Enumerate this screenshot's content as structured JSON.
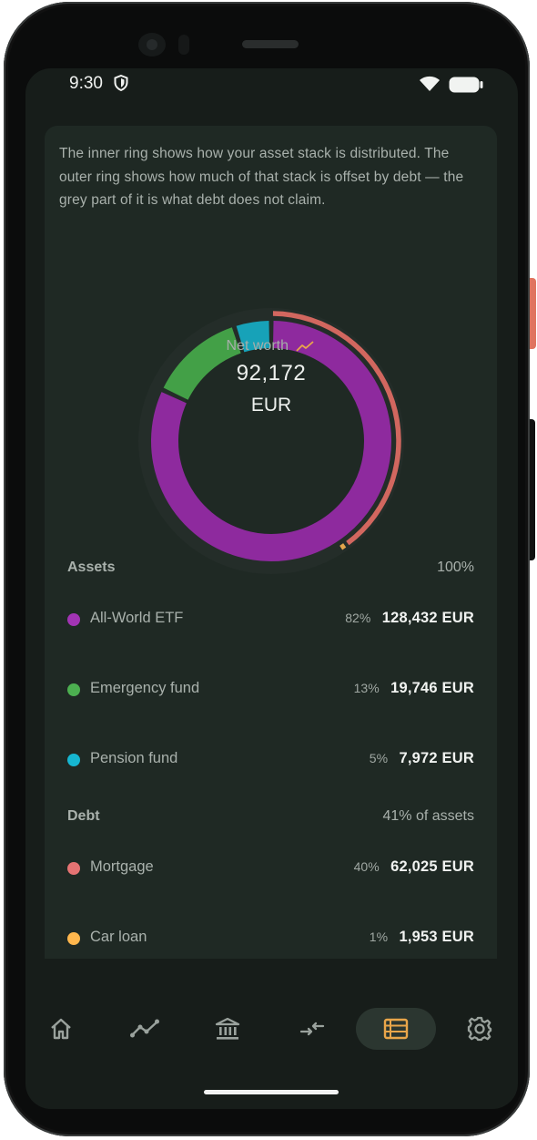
{
  "status_bar": {
    "time": "9:30",
    "icons": [
      "shield-icon",
      "wifi-icon",
      "battery-icon"
    ]
  },
  "intro_text": "The inner ring shows how your asset stack is distributed. The outer ring shows how much of that stack is offset by debt — the grey part of it is what debt does not claim.",
  "donut": {
    "label": "Net worth",
    "trend_icon": "trend-up-icon",
    "value": "92,172",
    "unit": "EUR",
    "colors": {
      "etf": "#8e2a9e",
      "emergency": "#43a047",
      "pension": "#17a2b8",
      "mortgage": "#d2675f",
      "car": "#e3a64c",
      "ring_track": "#242d29"
    }
  },
  "assets": {
    "title": "Assets",
    "total": "100%",
    "items": [
      {
        "name": "All-World ETF",
        "percent": "82%",
        "amount": "128,432 EUR",
        "color": "#a234b4",
        "share": 82
      },
      {
        "name": "Emergency fund",
        "percent": "13%",
        "amount": "19,746 EUR",
        "color": "#4caf50",
        "share": 13
      },
      {
        "name": "Pension fund",
        "percent": "5%",
        "amount": "7,972 EUR",
        "color": "#16b6d1",
        "share": 5
      }
    ]
  },
  "debt": {
    "title": "Debt",
    "total": "41% of assets",
    "items": [
      {
        "name": "Mortgage",
        "percent": "40%",
        "amount": "62,025 EUR",
        "color": "#e57373",
        "share": 40
      },
      {
        "name": "Car loan",
        "percent": "1%",
        "amount": "1,953 EUR",
        "color": "#ffb74d",
        "share": 1
      }
    ]
  },
  "nav": {
    "items": [
      {
        "icon": "home-icon",
        "active": false
      },
      {
        "icon": "chart-line-icon",
        "active": false
      },
      {
        "icon": "bank-icon",
        "active": false
      },
      {
        "icon": "transfer-icon",
        "active": false
      },
      {
        "icon": "list-icon",
        "active": true
      },
      {
        "icon": "settings-icon",
        "active": false
      }
    ],
    "active_color": "#e9a64a",
    "inactive_color": "#9aa29d"
  }
}
